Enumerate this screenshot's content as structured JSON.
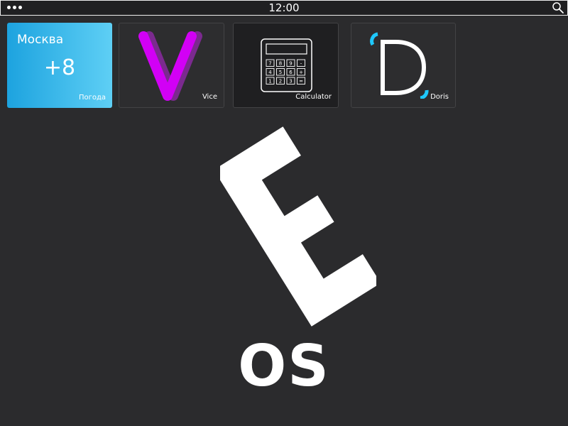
{
  "status_bar": {
    "menu_icon": "more-dots-icon",
    "time": "12:00",
    "search_icon": "search-icon"
  },
  "tiles": [
    {
      "id": "weather",
      "city": "Москва",
      "temperature": "+8",
      "label": "Погода",
      "colors": [
        "#1da3df",
        "#5ecff5"
      ]
    },
    {
      "id": "vice",
      "label": "Vice",
      "icon": "vice-v-logo",
      "colors": [
        "#d200f5",
        "#7b2a8f"
      ]
    },
    {
      "id": "calculator",
      "label": "Calculator",
      "icon": "calculator-icon",
      "keys": [
        "7",
        "8",
        "9",
        "-",
        "4",
        "5",
        "6",
        "+",
        "1",
        "2",
        "3",
        "="
      ]
    },
    {
      "id": "doris",
      "label": "Doris",
      "icon": "doris-d-logo",
      "colors": [
        "#1ec8ff",
        "#ffffff"
      ]
    }
  ],
  "brand": {
    "logo_letter": "E",
    "text": "OS",
    "color": "#ffffff"
  },
  "background_color": "#2b2b2d"
}
